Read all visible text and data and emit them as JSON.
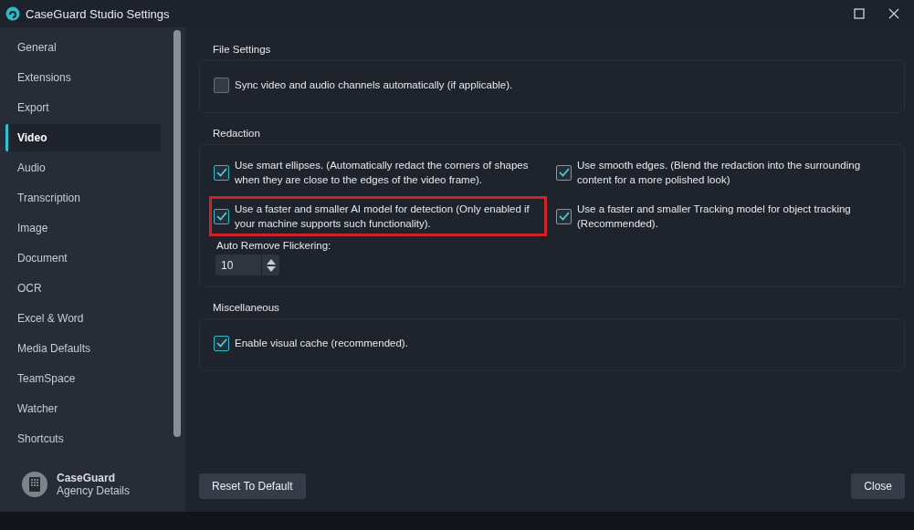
{
  "window": {
    "title": "CaseGuard Studio Settings"
  },
  "sidebar": {
    "items": [
      {
        "label": "General",
        "selected": false
      },
      {
        "label": "Extensions",
        "selected": false
      },
      {
        "label": "Export",
        "selected": false
      },
      {
        "label": "Video",
        "selected": true
      },
      {
        "label": "Audio",
        "selected": false
      },
      {
        "label": "Transcription",
        "selected": false
      },
      {
        "label": "Image",
        "selected": false
      },
      {
        "label": "Document",
        "selected": false
      },
      {
        "label": "OCR",
        "selected": false
      },
      {
        "label": "Excel & Word",
        "selected": false
      },
      {
        "label": "Media Defaults",
        "selected": false
      },
      {
        "label": "TeamSpace",
        "selected": false
      },
      {
        "label": "Watcher",
        "selected": false
      },
      {
        "label": "Shortcuts",
        "selected": false
      }
    ],
    "footer": {
      "name": "CaseGuard",
      "subtitle": "Agency Details"
    }
  },
  "groups": [
    {
      "title": "File Settings",
      "options": [
        {
          "label": "Sync video and audio channels automatically (if applicable).",
          "checked": false,
          "highlighted": false
        }
      ]
    },
    {
      "title": "Redaction",
      "options": [
        {
          "label": "Use smart ellipses. (Automatically redact the corners of shapes when they are close to the edges of the video frame).",
          "checked": true,
          "highlighted": false
        },
        {
          "label": "Use smooth edges. (Blend the redaction into the surrounding content for a more polished look)",
          "checked": true,
          "highlighted": false
        },
        {
          "label": "Use a faster and smaller AI model for detection (Only enabled if your machine supports such functionality).",
          "checked": true,
          "highlighted": true
        },
        {
          "label": "Use a faster and smaller Tracking model for object tracking (Recommended).",
          "checked": true,
          "highlighted": false
        }
      ],
      "spinner": {
        "label": "Auto Remove Flickering:",
        "value": "10"
      }
    },
    {
      "title": "Miscellaneous",
      "options": [
        {
          "label": "Enable visual cache (recommended).",
          "checked": true,
          "highlighted": false
        }
      ]
    }
  ],
  "buttons": {
    "reset": "Reset To Default",
    "close": "Close"
  }
}
